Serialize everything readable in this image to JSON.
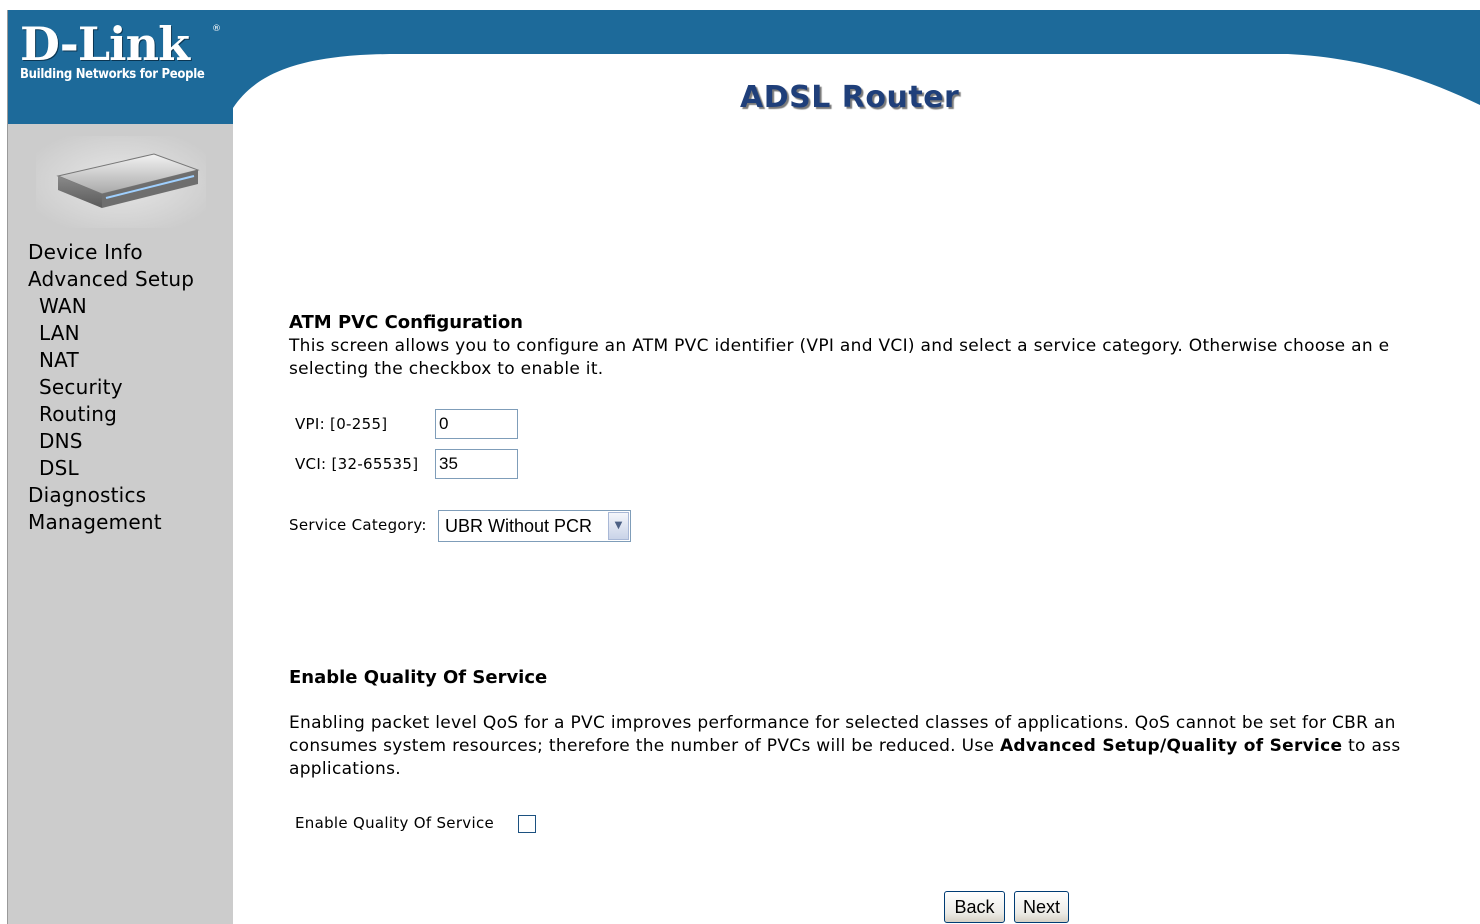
{
  "brand": {
    "logo_text": "D-Link",
    "logo_mark": "®",
    "tagline": "Building Networks for People",
    "page_title": "ADSL Router",
    "header_color": "#1d6a9a",
    "sidebar_color": "#cccccc"
  },
  "sidebar": {
    "items": [
      {
        "label": "Device Info",
        "level": 0
      },
      {
        "label": "Advanced Setup",
        "level": 0
      },
      {
        "label": "WAN",
        "level": 1
      },
      {
        "label": "LAN",
        "level": 1
      },
      {
        "label": "NAT",
        "level": 1
      },
      {
        "label": "Security",
        "level": 1
      },
      {
        "label": "Routing",
        "level": 1
      },
      {
        "label": "DNS",
        "level": 1
      },
      {
        "label": "DSL",
        "level": 1
      },
      {
        "label": "Diagnostics",
        "level": 0
      },
      {
        "label": "Management",
        "level": 0
      }
    ]
  },
  "atm": {
    "title": "ATM PVC Configuration",
    "desc_line1": "This screen allows you to configure an ATM PVC identifier (VPI and VCI) and select a service category. Otherwise choose an e",
    "desc_line2": "selecting the checkbox to enable it.",
    "vpi_label": "VPI: [0-255]",
    "vpi_value": "0",
    "vci_label": "VCI: [32-65535]",
    "vci_value": "35",
    "service_label": "Service Category:",
    "service_value": "UBR Without PCR"
  },
  "qos": {
    "title": "Enable Quality Of Service",
    "line1": "Enabling packet level QoS for a PVC improves performance for selected classes of applications.  QoS cannot be set for CBR an",
    "line2_pre": "consumes system resources; therefore the number of PVCs will be reduced. Use ",
    "line2_bold": "Advanced Setup/Quality of Service",
    "line2_post": " to ass",
    "line3": "applications.",
    "checkbox_label": "Enable Quality Of Service",
    "checked": false
  },
  "buttons": {
    "back": "Back",
    "next": "Next"
  }
}
